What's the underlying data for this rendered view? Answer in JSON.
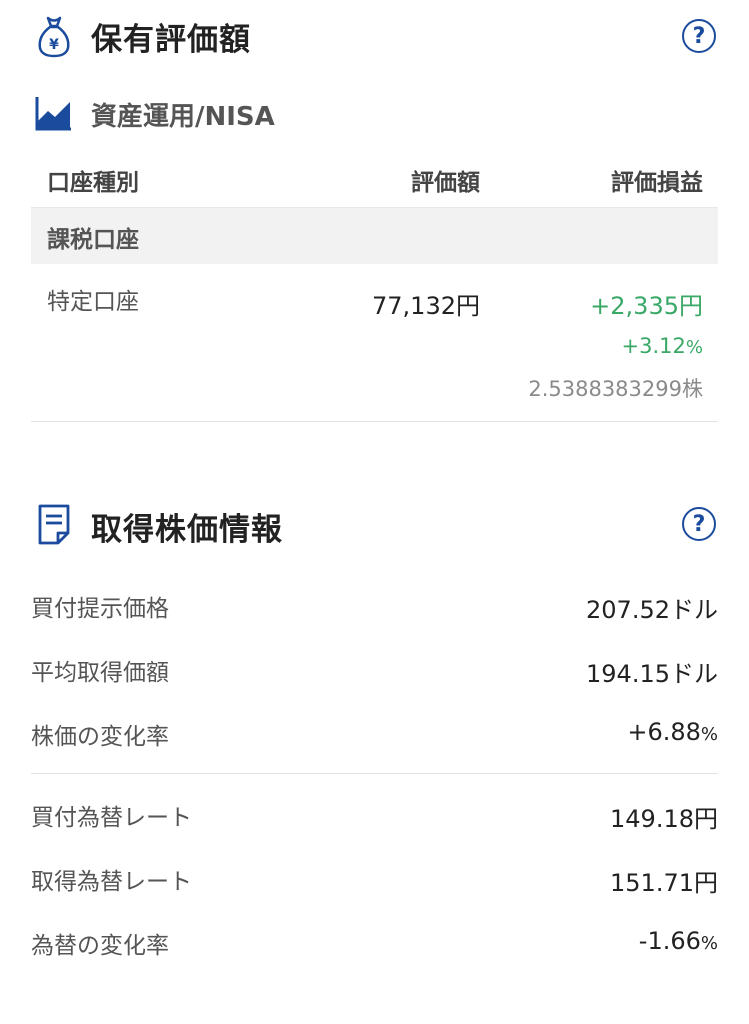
{
  "holdings": {
    "title": "保有評価額",
    "help_label": "?",
    "subsection_title": "資産運用/NISA",
    "columns": {
      "account_type": "口座種別",
      "valuation": "評価額",
      "pnl": "評価損益"
    },
    "group_label": "課税口座",
    "row": {
      "account": "特定口座",
      "valuation": "77,132円",
      "pnl_amount": "+2,335円",
      "pnl_percent_value": "+3.12",
      "pnl_percent_unit": "%",
      "shares_value": "2.5388383299",
      "shares_unit": "株"
    }
  },
  "acquisition": {
    "title": "取得株価情報",
    "help_label": "?",
    "rows": [
      {
        "label": "買付提示価格",
        "value": "207.52",
        "unit": "ドル"
      },
      {
        "label": "平均取得価額",
        "value": "194.15",
        "unit": "ドル"
      },
      {
        "label": "株価の変化率",
        "value": "+6.88",
        "unit": "%"
      },
      {
        "label": "買付為替レート",
        "value": "149.18",
        "unit": "円"
      },
      {
        "label": "取得為替レート",
        "value": "151.71",
        "unit": "円"
      },
      {
        "label": "為替の変化率",
        "value": "-1.66",
        "unit": "%"
      }
    ]
  },
  "colors": {
    "accent": "#1a4b9c",
    "positive": "#3aa866",
    "negative": "#e2556c"
  }
}
